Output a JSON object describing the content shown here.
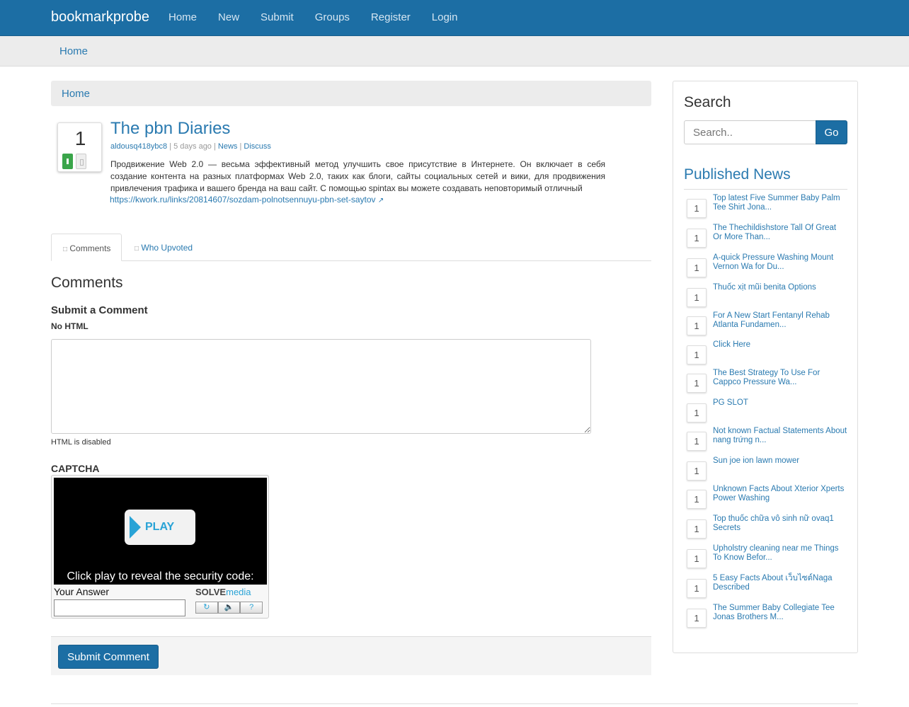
{
  "site": {
    "brand": "bookmarkprobe"
  },
  "nav": {
    "items": [
      "Home",
      "New",
      "Submit",
      "Groups",
      "Register",
      "Login"
    ]
  },
  "subbar": {
    "home": "Home"
  },
  "breadcrumb": {
    "home": "Home"
  },
  "post": {
    "votes": "1",
    "title": "The pbn Diaries",
    "author": "aldousq418ybc8",
    "age": "5 days ago",
    "category": "News",
    "discuss": "Discuss",
    "body": "Продвижение Web 2.0 — весьма эффективный метод улучшить свое присутствие в Интернете. Он включает в себя создание контента на разных платформах Web 2.0, таких как блоги, сайты социальных сетей и вики, для продвижения привлечения трафика и вашего бренда на ваш сайт. С помощью spintax вы можете создавать неповторимый отличный",
    "link": "https://kwork.ru/links/20814607/sozdam-polnotsennuyu-pbn-set-saytov"
  },
  "tabs": {
    "comments": "Comments",
    "who_upvoted": "Who Upvoted"
  },
  "comments": {
    "heading": "Comments",
    "submit_heading": "Submit a Comment",
    "no_html": "No HTML",
    "html_disabled": "HTML is disabled",
    "captcha_label": "CAPTCHA",
    "submit_label": "Submit Comment"
  },
  "captcha": {
    "play": "PLAY",
    "prompt": "Click play to reveal the security code:",
    "answer_label": "Your Answer",
    "logo_solve": "SOLVE",
    "logo_media": "media"
  },
  "sidebar": {
    "search_heading": "Search",
    "search_placeholder": "Search..",
    "go_label": "Go",
    "published_heading": "Published News",
    "items": [
      {
        "count": "1",
        "title": "Top latest Five Summer Baby Palm Tee Shirt Jona..."
      },
      {
        "count": "1",
        "title": "The Thechildishstore Tall Of Great Or More Than..."
      },
      {
        "count": "1",
        "title": "A-quick Pressure Washing Mount Vernon Wa for Du..."
      },
      {
        "count": "1",
        "title": "Thuốc xịt mũi benita Options"
      },
      {
        "count": "1",
        "title": "For A New Start Fentanyl Rehab Atlanta Fundamen..."
      },
      {
        "count": "1",
        "title": "Click Here"
      },
      {
        "count": "1",
        "title": "The Best Strategy To Use For Cappco Pressure Wa..."
      },
      {
        "count": "1",
        "title": "PG SLOT"
      },
      {
        "count": "1",
        "title": "Not known Factual Statements About nang trứng n..."
      },
      {
        "count": "1",
        "title": "Sun joe ion lawn mower"
      },
      {
        "count": "1",
        "title": "Unknown Facts About Xterior Xperts Power Washing"
      },
      {
        "count": "1",
        "title": "Top thuốc chữa vô sinh nữ ovaq1 Secrets"
      },
      {
        "count": "1",
        "title": "Upholstry cleaning near me Things To Know Befor..."
      },
      {
        "count": "1",
        "title": "5 Easy Facts About เว็บไซต์Naga Described"
      },
      {
        "count": "1",
        "title": "The Summer Baby Collegiate Tee Jonas Brothers M..."
      }
    ]
  }
}
